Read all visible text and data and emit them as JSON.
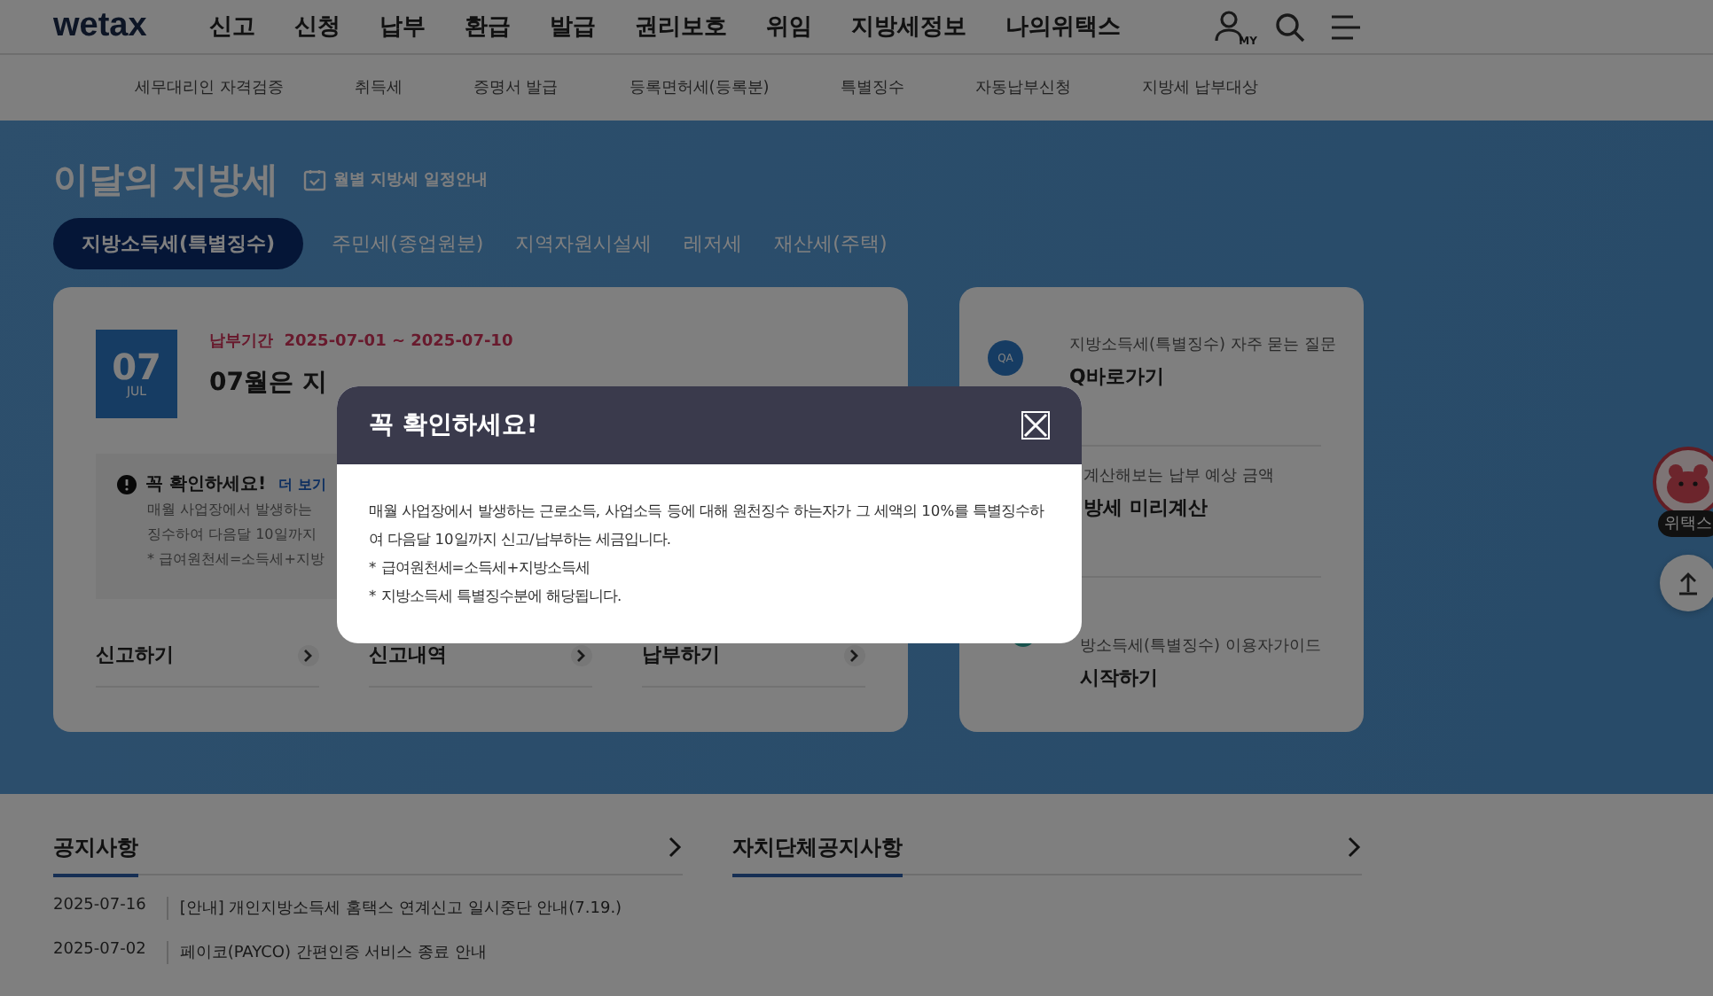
{
  "header": {
    "logo": "wetax",
    "nav": [
      "신고",
      "신청",
      "납부",
      "환급",
      "발급",
      "권리보호",
      "위임",
      "지방세정보",
      "나의위택스"
    ],
    "my_label": "MY"
  },
  "submenu": [
    "세무대리인 자격검증",
    "취득세",
    "증명서 발급",
    "등록면허세(등록분)",
    "특별징수",
    "자동납부신청",
    "지방세 납부대상"
  ],
  "monthly": {
    "title": "이달의 지방세",
    "schedule_link": "월별 지방세 일정안내",
    "tabs": [
      {
        "label": "지방소득세(특별징수)",
        "selected": true
      },
      {
        "label": "주민세(종업원분)",
        "selected": false
      },
      {
        "label": "지역자원시설세",
        "selected": false
      },
      {
        "label": "레저세",
        "selected": false
      },
      {
        "label": "재산세(주택)",
        "selected": false
      }
    ],
    "main_card": {
      "month": "07",
      "month_en": "JUL",
      "period_label": "납부기간",
      "period": "2025-07-01 ~ 2025-07-10",
      "heading": "07월은 지",
      "notice_title": "꼭 확인하세요!",
      "more_link": "더 보기",
      "notice_lines": [
        "매월 사업장에서 발생하는",
        "징수하여 다음달 10일까지",
        "* 급여원천세=소득세+지방"
      ],
      "links": [
        "신고하기",
        "신고내역",
        "납부하기"
      ]
    },
    "side_card": [
      {
        "kind": "qa",
        "caption": "지방소득세(특별징수) 자주 묻는 질문",
        "title": "Q바로가기",
        "icon_text": "QA"
      },
      {
        "kind": "calc",
        "caption": "계산해보는 납부 예상 금액",
        "title": "방세 미리계산"
      },
      {
        "kind": "guide",
        "caption": "방소득세(특별징수) 이용자가이드",
        "title": "시작하기"
      }
    ]
  },
  "floating": {
    "mascot_label": "위택스"
  },
  "notices": {
    "title": "공지사항",
    "rows": [
      {
        "date": "2025-07-16",
        "text": "[안내] 개인지방소득세 홈택스 연계신고 일시중단 안내(7.19.)"
      },
      {
        "date": "2025-07-02",
        "text": "페이코(PAYCO) 간편인증 서비스 종료 안내"
      }
    ]
  },
  "local_notices": {
    "title": "자치단체공지사항"
  },
  "modal": {
    "title": "꼭 확인하세요!",
    "lines": [
      "매월 사업장에서 발생하는 근로소득, 사업소득 등에 대해 원천징수 하는자가 그 세액의 10%를 특별징수하여 다음달 10일까지 신고/납부하는 세금입니다.",
      "* 급여원천세=소득세+지방소득세",
      "* 지방소득세 특별징수분에 해당됩니다."
    ]
  }
}
